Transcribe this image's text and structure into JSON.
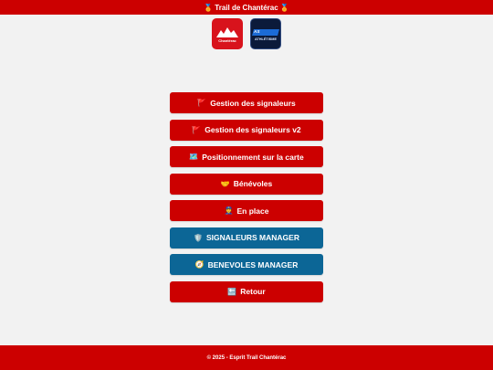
{
  "header": {
    "title": "🏅 Trail de Chantérac 🏅"
  },
  "logos": {
    "left": {
      "icon": "chanterac-logo",
      "text": "Chantérac"
    },
    "right": {
      "icon": "athletisme-logo",
      "line1": "AS",
      "line2": "ATHLÉTISME"
    }
  },
  "menu": {
    "items": [
      {
        "icon": "🚩",
        "label": "Gestion des signaleurs",
        "color": "#cc0000"
      },
      {
        "icon": "🚩",
        "label": "Gestion des signaleurs v2",
        "color": "#cc0000"
      },
      {
        "icon": "🗺️",
        "label": "Positionnement sur la carte",
        "color": "#cc0000"
      },
      {
        "icon": "🤝",
        "label": "Bénévoles",
        "color": "#cc0000"
      },
      {
        "icon": "👮",
        "label": "En place",
        "color": "#cc0000"
      },
      {
        "icon": "🛡️",
        "label": "SIGNALEURS MANAGER",
        "color": "#0c6696"
      },
      {
        "icon": "🧭",
        "label": "BENEVOLES MANAGER",
        "color": "#0c6696"
      },
      {
        "icon": "🔙",
        "label": "Retour",
        "color": "#cc0000"
      }
    ]
  },
  "footer": {
    "text": "© 2025 - Esprit Trail Chantérac"
  },
  "colors": {
    "brand_red": "#cc0000",
    "manager_blue": "#0c6696",
    "background": "#f2f2f2"
  }
}
